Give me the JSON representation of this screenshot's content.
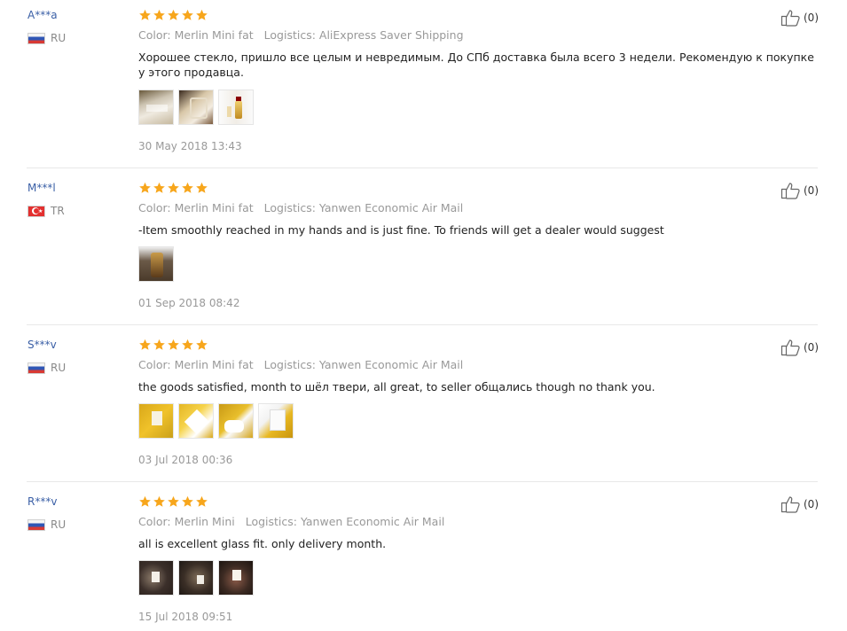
{
  "reviews": [
    {
      "user": "A***a",
      "country": "RU",
      "flag": "ru",
      "rating": 5,
      "color_label": "Color: Merlin Mini fat",
      "logistics_label": "Logistics: AliExpress Saver Shipping",
      "text": "Хорошее стекло, пришло все целым и невредимым. До СПб доставка была всего 3 недели. Рекомендую к покупке у этого продавца.",
      "photos": [
        "white-bag",
        "box",
        "bottle"
      ],
      "date": "30 May 2018 13:43",
      "helpful": "(0)"
    },
    {
      "user": "M***l",
      "country": "TR",
      "flag": "tr",
      "rating": 5,
      "color_label": "Color: Merlin Mini fat",
      "logistics_label": "Logistics: Yanwen Economic Air Mail",
      "text": "-Item smoothly reached in my hands and is just fine. To friends will get a dealer would suggest",
      "photos": [
        "dark-bottle"
      ],
      "date": "01 Sep 2018 08:42",
      "helpful": "(0)"
    },
    {
      "user": "S***v",
      "country": "RU",
      "flag": "ru",
      "rating": 5,
      "color_label": "Color: Merlin Mini fat",
      "logistics_label": "Logistics: Yanwen Economic Air Mail",
      "text": "the goods satisfied, month to шёл твери, all great, to seller общались though no thank you.",
      "photos": [
        "yellow1",
        "yellow2",
        "yellow3",
        "yellow4"
      ],
      "date": "03 Jul 2018 00:36",
      "helpful": "(0)"
    },
    {
      "user": "R***v",
      "country": "RU",
      "flag": "ru",
      "rating": 5,
      "color_label": "Color: Merlin Mini",
      "logistics_label": "Logistics: Yanwen Economic Air Mail",
      "text": "all is excellent glass fit. only delivery month.",
      "photos": [
        "dark1",
        "dark2",
        "dark3"
      ],
      "date": "15 Jul 2018 09:51",
      "helpful": "(0)"
    }
  ],
  "colors": {
    "star": "#f7a61c",
    "username": "#3a5fa6",
    "meta": "#999999"
  }
}
